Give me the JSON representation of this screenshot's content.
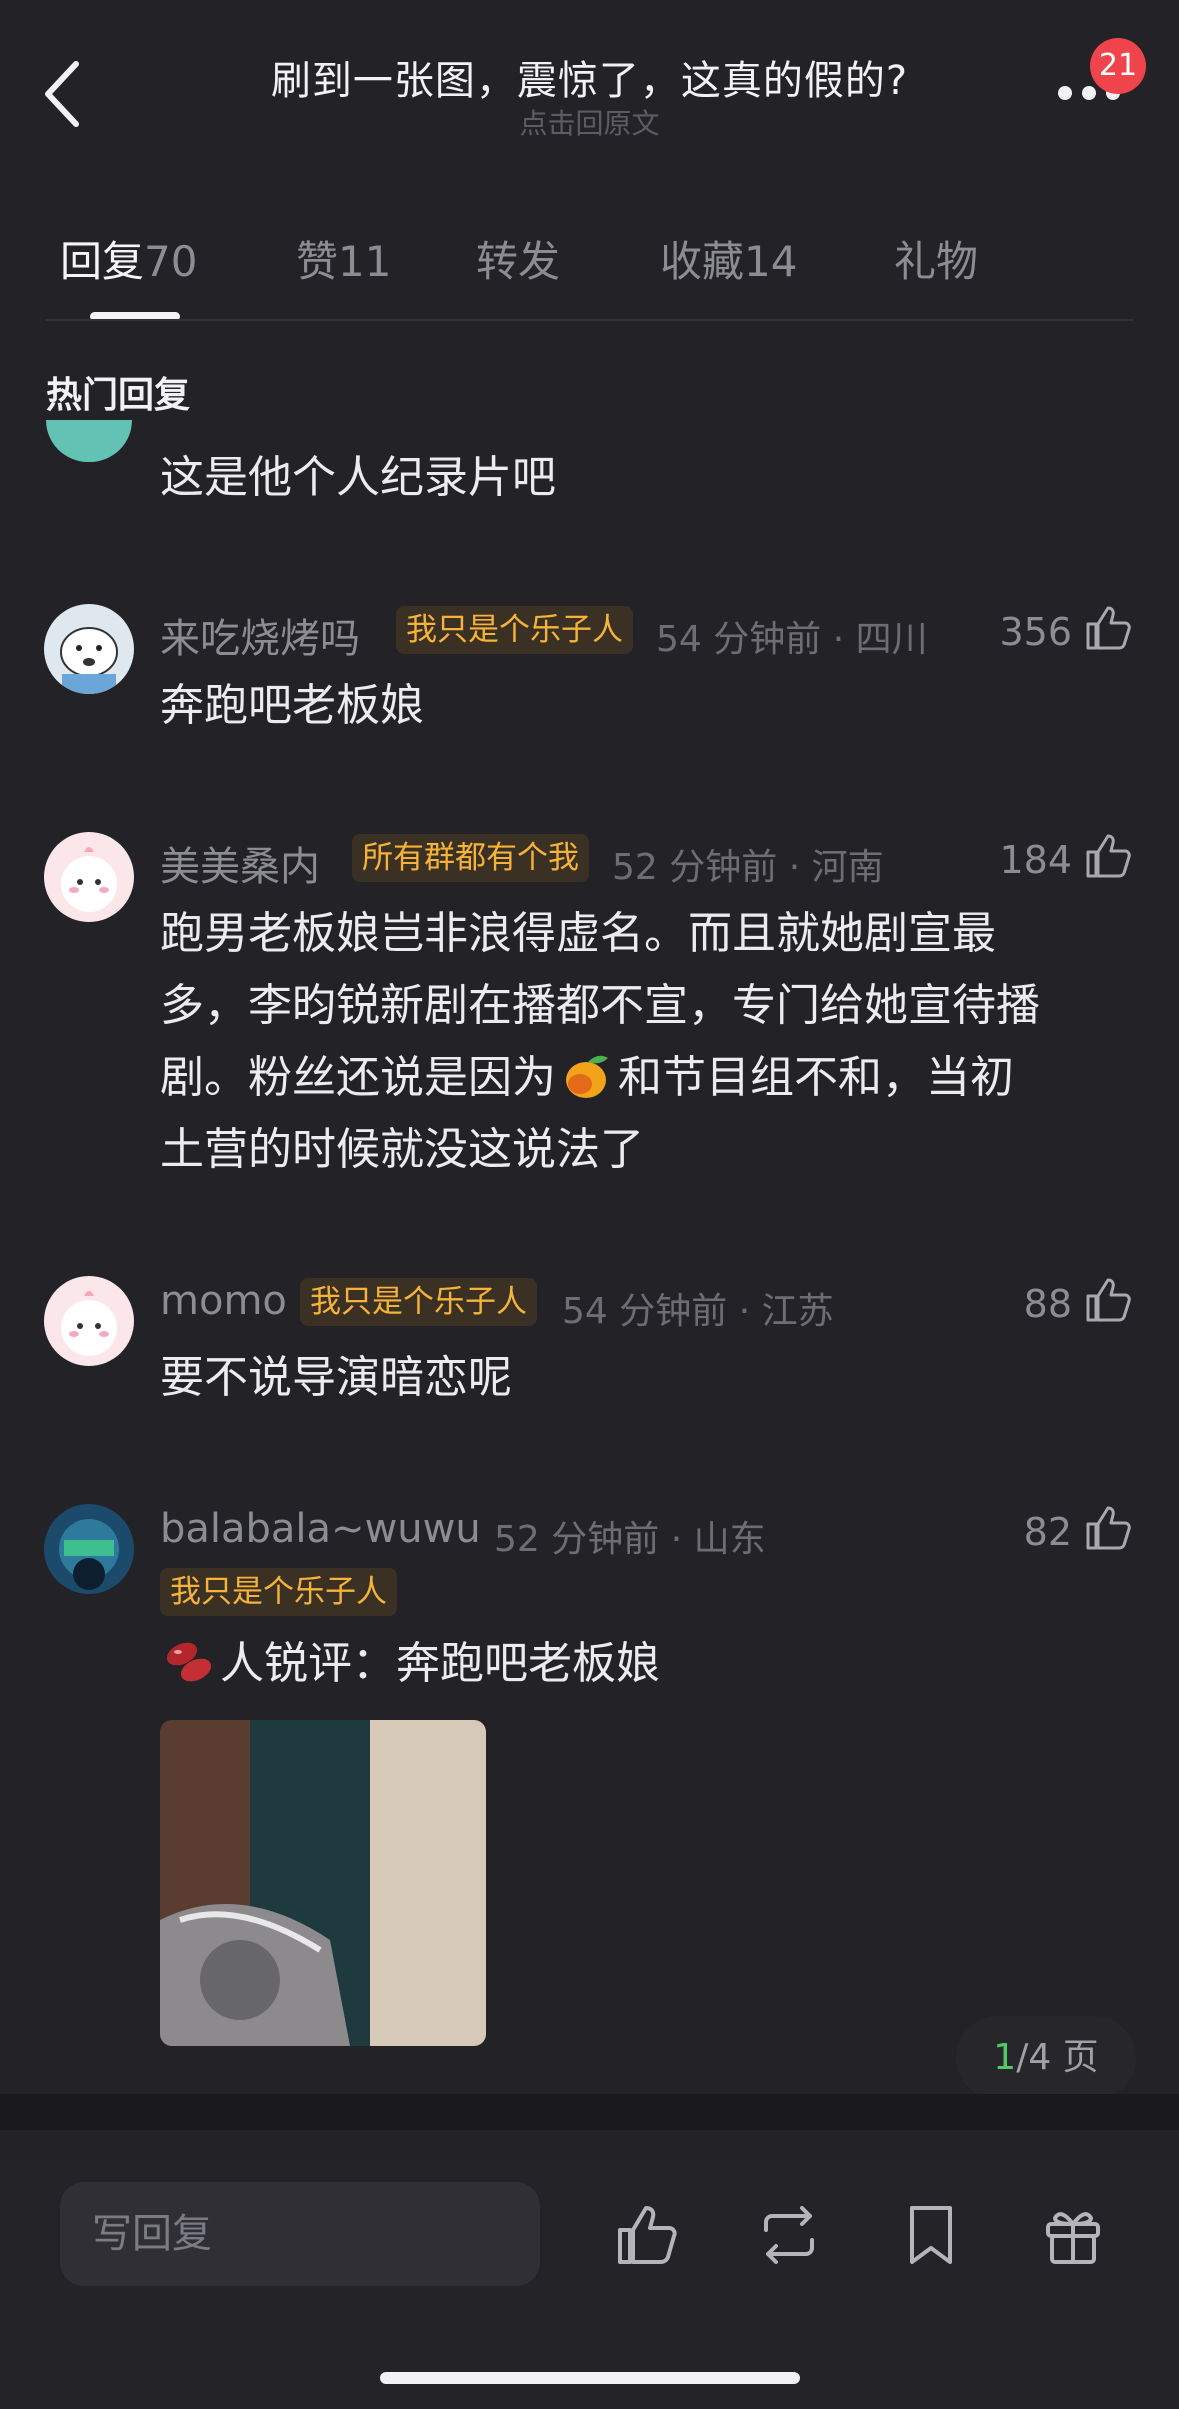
{
  "header": {
    "title": "刷到一张图，震惊了，这真的假的?",
    "subtitle": "点击回原文",
    "notification_count": "21"
  },
  "tabs": [
    {
      "label": "回复",
      "count": "70",
      "active": true
    },
    {
      "label": "赞",
      "count": "11"
    },
    {
      "label": "转发",
      "count": ""
    },
    {
      "label": "收藏",
      "count": "14"
    },
    {
      "label": "礼物",
      "count": ""
    }
  ],
  "section_title": "热门回复",
  "partial_comment": {
    "text": "这是他个人纪录片吧"
  },
  "comments": [
    {
      "username": "来吃烧烤吗",
      "tag": "我只是个乐子人",
      "meta": "54 分钟前 · 四川",
      "likes": "356",
      "lines": [
        "奔跑吧老板娘"
      ]
    },
    {
      "username": "美美桑内",
      "tag": "所有群都有个我",
      "meta": "52 分钟前 · 河南",
      "likes": "184",
      "lines": [
        "跑男老板娘岂非浪得虚名。而且就她剧宣最",
        "多，李昀锐新剧在播都不宣，专门给她宣待播",
        "剧。粉丝还说是因为",
        "和节目组不和，当初",
        "土营的时候就没这说法了"
      ]
    },
    {
      "username": "momo",
      "tag": "我只是个乐子人",
      "meta": "54 分钟前 · 江苏",
      "likes": "88",
      "lines": [
        "要不说导演暗恋呢"
      ]
    },
    {
      "username": "balabala~wuwu",
      "tag": "我只是个乐子人",
      "meta": "52 分钟前 · 山东",
      "likes": "82",
      "lines": [
        "人锐评：奔跑吧老板娘"
      ]
    }
  ],
  "pager": {
    "current": "1",
    "total": "/4 页"
  },
  "bottom_bar": {
    "reply_placeholder": "写回复"
  },
  "colors": {
    "background": "#222227",
    "tag_text": "#f6b239",
    "badge": "#f0444d",
    "pager_current": "#4fc86a"
  }
}
